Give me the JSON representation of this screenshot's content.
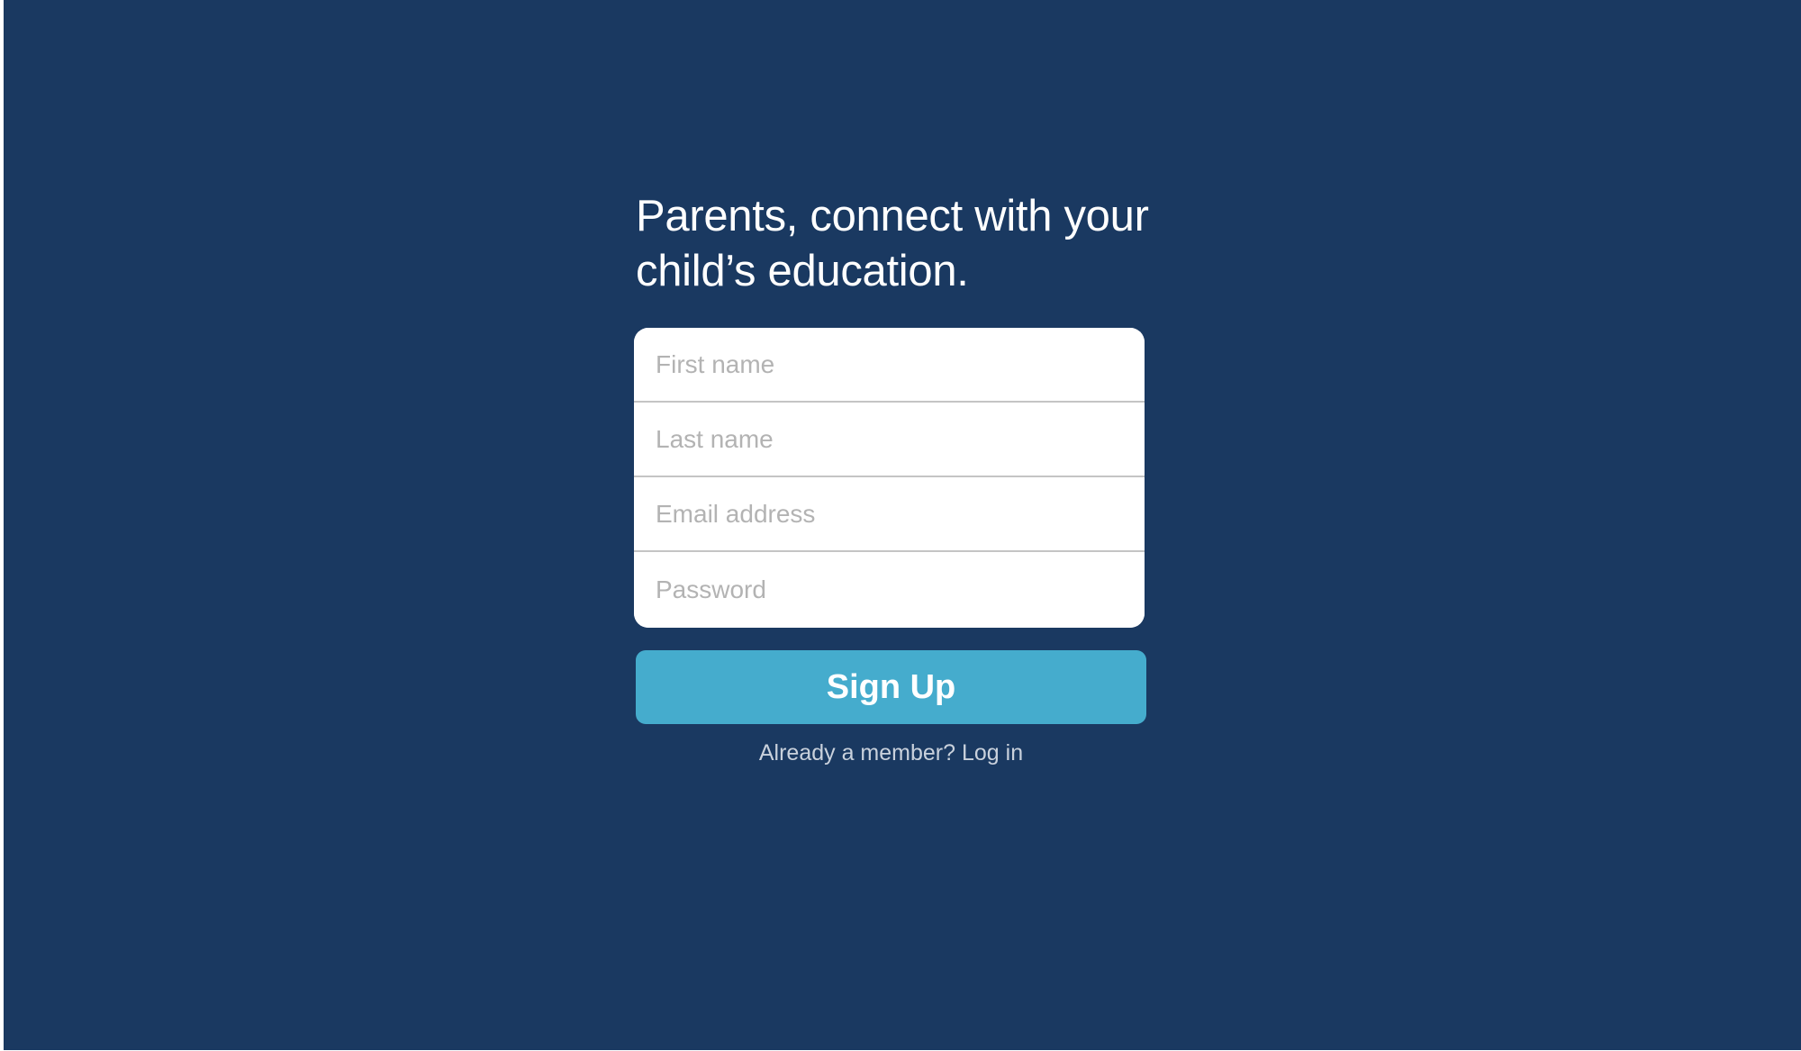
{
  "signup": {
    "headline": "Parents, connect with your child’s education.",
    "fields": [
      {
        "name": "first-name",
        "type": "text",
        "placeholder": "First name",
        "value": ""
      },
      {
        "name": "last-name",
        "type": "text",
        "placeholder": "Last name",
        "value": ""
      },
      {
        "name": "email",
        "type": "email",
        "placeholder": "Email address",
        "value": ""
      },
      {
        "name": "password",
        "type": "password",
        "placeholder": "Password",
        "value": ""
      }
    ],
    "submit_label": "Sign Up",
    "member_prompt": "Already a member?",
    "login_label": "Log in"
  },
  "colors": {
    "background": "#1a3961",
    "button": "#45accd",
    "card": "#ffffff",
    "placeholder": "#b3b3b3"
  }
}
